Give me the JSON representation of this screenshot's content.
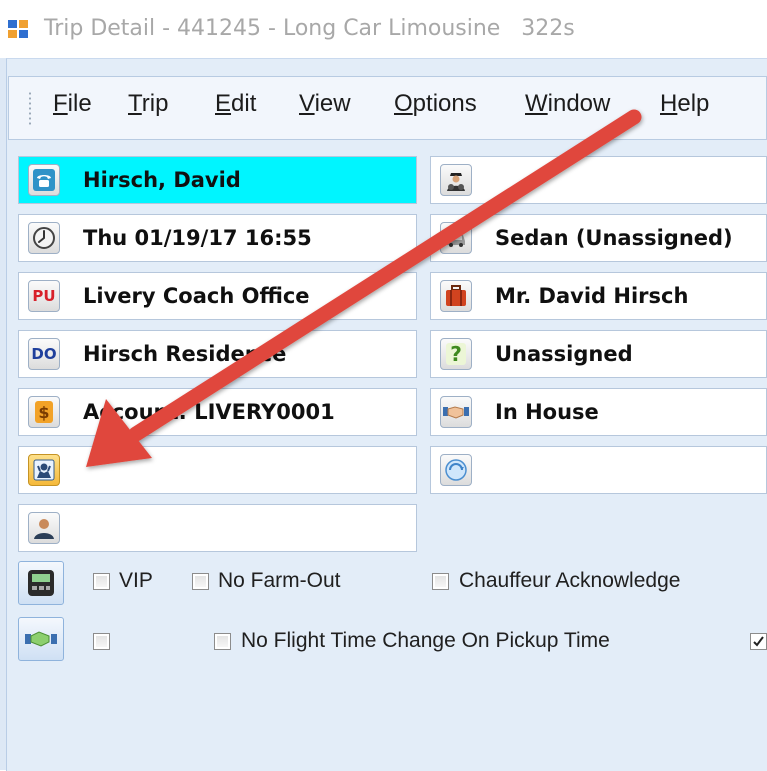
{
  "window": {
    "title": "Trip Detail - 441245 - Long Car Limousine   322s"
  },
  "menu": {
    "items": [
      {
        "key": "F",
        "rest": "ile"
      },
      {
        "key": "T",
        "rest": "rip"
      },
      {
        "key": "E",
        "rest": "dit"
      },
      {
        "key": "V",
        "rest": "iew"
      },
      {
        "key": "O",
        "rest": "ptions"
      },
      {
        "key": "W",
        "rest": "indow"
      },
      {
        "key": "H",
        "rest": "elp"
      }
    ]
  },
  "left_fields": {
    "customer": "Hirsch, David",
    "datetime": "Thu 01/19/17 16:55",
    "pickup": "Livery Coach Office",
    "dropoff": "Hirsch Residence",
    "account": "Account: LIVERY0001",
    "greeter": "",
    "contact": ""
  },
  "right_fields": {
    "chauffeur": "",
    "vehicle": "Sedan (Unassigned)",
    "passenger": "Mr. David Hirsch",
    "status": "Unassigned",
    "affiliate": "In House",
    "extra": ""
  },
  "icons": {
    "customer": "phone-icon",
    "datetime": "clock-icon",
    "pickup": "pu-badge-icon",
    "dropoff": "do-badge-icon",
    "account": "dollar-icon",
    "greeter": "greeter-icon",
    "contact": "person-icon",
    "chauffeur": "chauffeur-icon",
    "vehicle": "car-icon",
    "passenger": "luggage-icon",
    "status": "question-icon",
    "affiliate": "handshake-icon",
    "extra": "globe-icon"
  },
  "pickup_badge": "PU",
  "dropoff_badge": "DO",
  "options": {
    "vip": "VIP",
    "no_farm_out": "No Farm-Out",
    "chauffeur_ack": "Chauffeur Acknowledge",
    "no_flight_change": "No Flight Time Change On Pickup Time"
  },
  "colors": {
    "highlight": "#00f5ff",
    "annotation_arrow": "#e0473d"
  }
}
